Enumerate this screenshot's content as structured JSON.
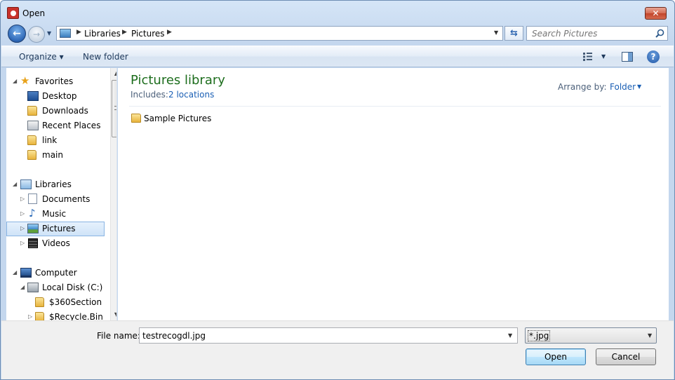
{
  "window": {
    "title": "Open",
    "close_glyph": "✕"
  },
  "nav": {
    "back_glyph": "←",
    "forward_glyph": "→",
    "breadcrumbs": [
      "Libraries",
      "Pictures"
    ],
    "refresh_glyph": "⇆",
    "search": {
      "placeholder": "Search Pictures",
      "value": ""
    }
  },
  "toolbar": {
    "organize_label": "Organize ▾",
    "new_folder_label": "New folder",
    "help_glyph": "?"
  },
  "sidebar": {
    "favorites": {
      "label": "Favorites",
      "items": [
        "Desktop",
        "Downloads",
        "Recent Places",
        "link",
        "main"
      ]
    },
    "libraries": {
      "label": "Libraries",
      "items": [
        "Documents",
        "Music",
        "Pictures",
        "Videos"
      ],
      "selected": "Pictures"
    },
    "computer": {
      "label": "Computer",
      "items": [
        "Local Disk (C:)",
        "$360Section",
        "$Recycle.Bin"
      ]
    }
  },
  "content": {
    "library_title": "Pictures library",
    "includes_label": "Includes:",
    "includes_link": "2 locations",
    "arrange_label": "Arrange by:",
    "arrange_value": "Folder",
    "items": [
      {
        "name": "Sample Pictures",
        "icon": "folder-icon"
      }
    ]
  },
  "footer": {
    "file_name_label": "File name:",
    "file_name_value": "testrecogdl.jpg",
    "file_type_value": "*.jpg",
    "open_label": "Open",
    "cancel_label": "Cancel"
  },
  "colors": {
    "library_title": "#1e6e1e",
    "link": "#1a5fb4",
    "selection_border": "#89b4e3"
  }
}
